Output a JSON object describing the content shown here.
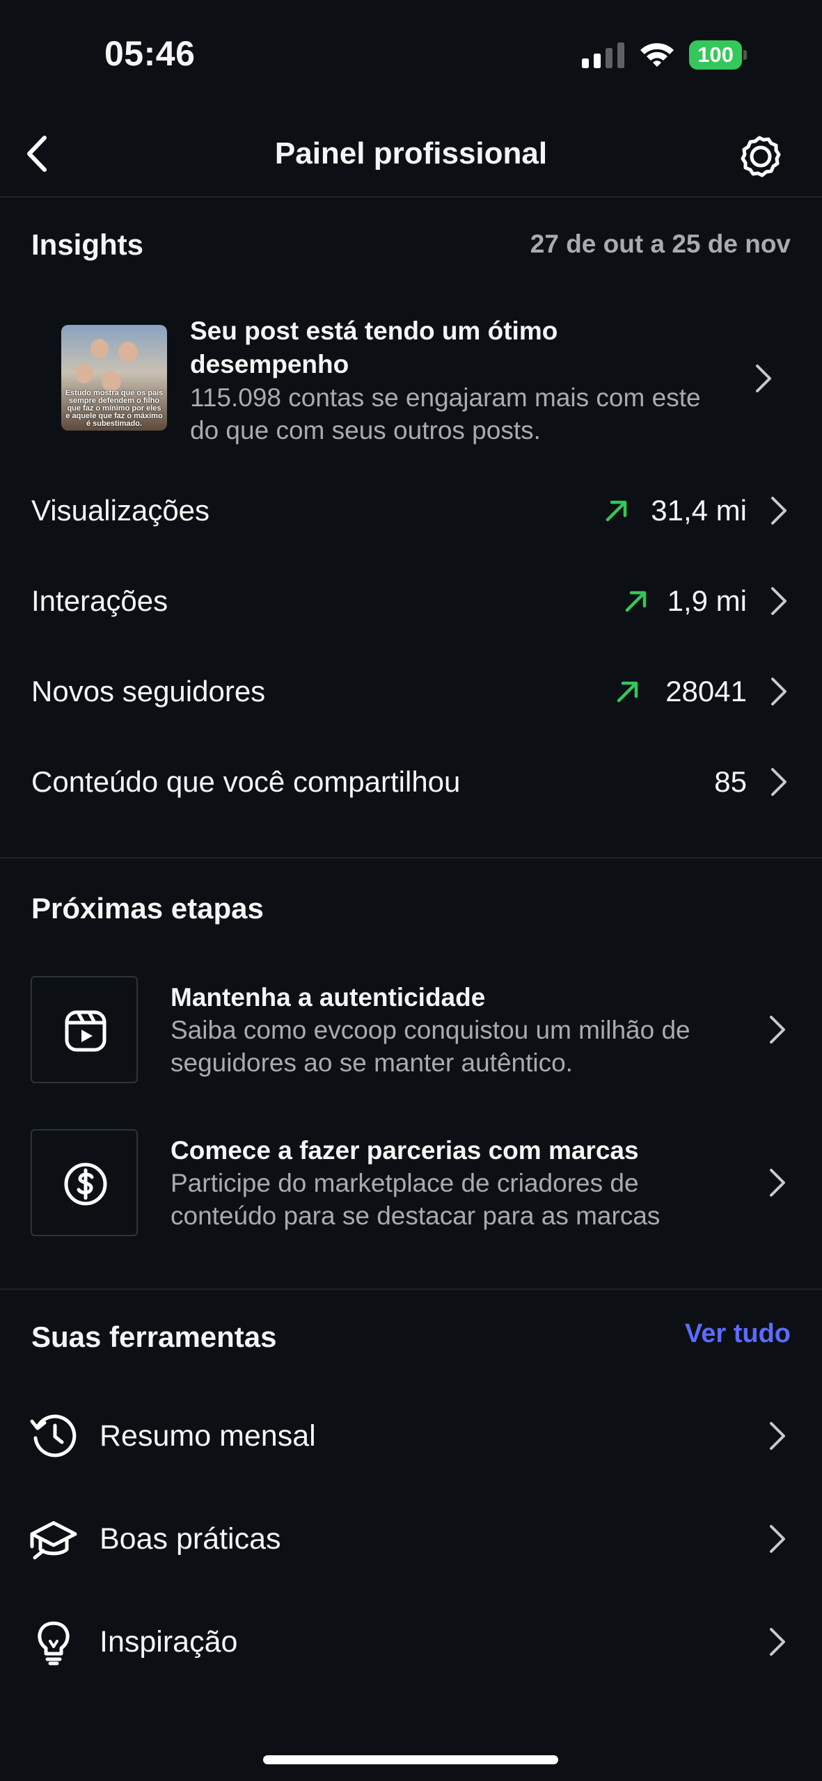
{
  "status_bar": {
    "time": "05:46",
    "battery": "100"
  },
  "header": {
    "title": "Painel profissional"
  },
  "insights": {
    "title": "Insights",
    "date_range": "27 de out a 25 de nov",
    "post": {
      "thumbnail_caption": "Estudo mostra que os pais sempre defendem o filho que faz o mínimo por eles e aquele que faz o máximo é subestimado.",
      "title": "Seu post está tendo um ótimo desempenho",
      "description": "115.098 contas se engajaram mais com este do que com seus outros posts."
    },
    "metrics": [
      {
        "label": "Visualizações",
        "value": "31,4 mi",
        "trend": "up"
      },
      {
        "label": "Interações",
        "value": "1,9 mi",
        "trend": "up"
      },
      {
        "label": "Novos seguidores",
        "value": "28041",
        "trend": "up"
      },
      {
        "label": "Conteúdo que você compartilhou",
        "value": "85",
        "trend": "none"
      }
    ]
  },
  "next_steps": {
    "title": "Próximas etapas",
    "items": [
      {
        "icon": "reels-icon",
        "title": "Mantenha a autenticidade",
        "description": "Saiba como evcoop conquistou um milhão de seguidores ao se manter autêntico."
      },
      {
        "icon": "dollar-icon",
        "title": "Comece a fazer parcerias com marcas",
        "description": "Participe do marketplace de criadores de conteúdo para se destacar para as marcas"
      }
    ]
  },
  "tools": {
    "title": "Suas ferramentas",
    "see_all": "Ver tudo",
    "items": [
      {
        "icon": "history-icon",
        "label": "Resumo mensal"
      },
      {
        "icon": "graduation-cap-icon",
        "label": "Boas práticas"
      },
      {
        "icon": "lightbulb-icon",
        "label": "Inspiração"
      }
    ]
  },
  "colors": {
    "background": "#0c1014",
    "trend_up": "#34c759",
    "link": "#5b6cff",
    "muted_text": "#a8abb0",
    "battery": "#34c759"
  }
}
